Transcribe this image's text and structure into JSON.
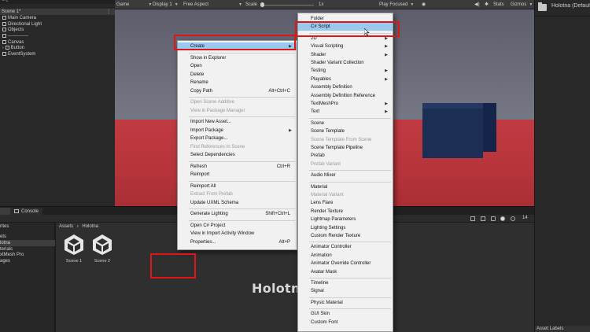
{
  "hierarchy": {
    "partial": "ㄹc",
    "scene": "Scene 1*",
    "items": [
      "Main Camera",
      "Directional Light",
      "Objects",
      "-------------",
      "Canvas",
      "Button",
      "EventSystem"
    ]
  },
  "game_toolbar": {
    "tab": "Game",
    "display": "Display 1",
    "aspect": "Free Aspect",
    "scale_label": "Scale",
    "scale_value": "1x",
    "play_focused": "Play Focused",
    "stats": "Stats",
    "gizmos": "Gizmos"
  },
  "inspector": {
    "title": "Holotna (Default",
    "asset_labels": "Asset Labels"
  },
  "bottom": {
    "console_tab": "Console",
    "count": "14",
    "breadcrumb_root": "Assets",
    "breadcrumb_sep": "›",
    "breadcrumb_folder": "Holotna",
    "left_items": [
      "rites",
      "ets",
      "lotna",
      "terials",
      "xtMesh Pro",
      "ages"
    ],
    "assets": [
      "Scene 1",
      "Scene 2"
    ],
    "watermark": "Holotna"
  },
  "context_menu": {
    "items": [
      {
        "label": "Create",
        "state": "highlighted",
        "submenu": true
      },
      {
        "label": "Show in Explorer"
      },
      {
        "label": "Open"
      },
      {
        "label": "Delete"
      },
      {
        "label": "Rename"
      },
      {
        "label": "Copy Path",
        "shortcut": "Alt+Ctrl+C"
      },
      {
        "label": "Open Scene Additive",
        "state": "disabled"
      },
      {
        "label": "View in Package Manager",
        "state": "disabled"
      },
      {
        "label": "Import New Asset..."
      },
      {
        "label": "Import Package",
        "submenu": true
      },
      {
        "label": "Export Package..."
      },
      {
        "label": "Find References In Scene",
        "state": "disabled"
      },
      {
        "label": "Select Dependencies"
      },
      {
        "label": "Refresh",
        "shortcut": "Ctrl+R"
      },
      {
        "label": "Reimport"
      },
      {
        "label": "Reimport All"
      },
      {
        "label": "Extract From Prefab",
        "state": "disabled"
      },
      {
        "label": "Update UXML Schema"
      },
      {
        "label": "Generate Lighting",
        "shortcut": "Shift+Ctrl+L"
      },
      {
        "label": "Open C# Project"
      },
      {
        "label": "View in Import Activity Window"
      },
      {
        "label": "Properties...",
        "shortcut": "Alt+P"
      }
    ]
  },
  "create_submenu": {
    "items": [
      {
        "label": "Folder"
      },
      {
        "label": "C# Script",
        "state": "highlighted"
      },
      {
        "label": "2D",
        "submenu": true
      },
      {
        "label": "Visual Scripting",
        "submenu": true
      },
      {
        "label": "Shader",
        "submenu": true
      },
      {
        "label": "Shader Variant Collection"
      },
      {
        "label": "Testing",
        "submenu": true
      },
      {
        "label": "Playables",
        "submenu": true
      },
      {
        "label": "Assembly Definition"
      },
      {
        "label": "Assembly Definition Reference"
      },
      {
        "label": "TextMeshPro",
        "submenu": true
      },
      {
        "label": "Text",
        "submenu": true
      },
      {
        "label": "Scene"
      },
      {
        "label": "Scene Template"
      },
      {
        "label": "Scene Template From Scene",
        "state": "disabled"
      },
      {
        "label": "Scene Template Pipeline"
      },
      {
        "label": "Prefab"
      },
      {
        "label": "Prefab Variant",
        "state": "disabled"
      },
      {
        "label": "Audio Mixer"
      },
      {
        "label": "Material"
      },
      {
        "label": "Material Variant",
        "state": "disabled"
      },
      {
        "label": "Lens Flare"
      },
      {
        "label": "Render Texture"
      },
      {
        "label": "Lightmap Parameters"
      },
      {
        "label": "Lighting Settings"
      },
      {
        "label": "Custom Render Texture"
      },
      {
        "label": "Animator Controller"
      },
      {
        "label": "Animation"
      },
      {
        "label": "Animator Override Controller"
      },
      {
        "label": "Avatar Mask"
      },
      {
        "label": "Timeline"
      },
      {
        "label": "Signal"
      },
      {
        "label": "Physic Material"
      },
      {
        "label": "GUI Skin"
      },
      {
        "label": "Custom Font"
      }
    ]
  },
  "colors": {
    "menu_bg": "#f1f1f1",
    "menu_highlight": "#99c9ef",
    "annotation_red": "#e01616",
    "floor_red": "#c03a42",
    "cube_blue": "#1d2e55"
  }
}
